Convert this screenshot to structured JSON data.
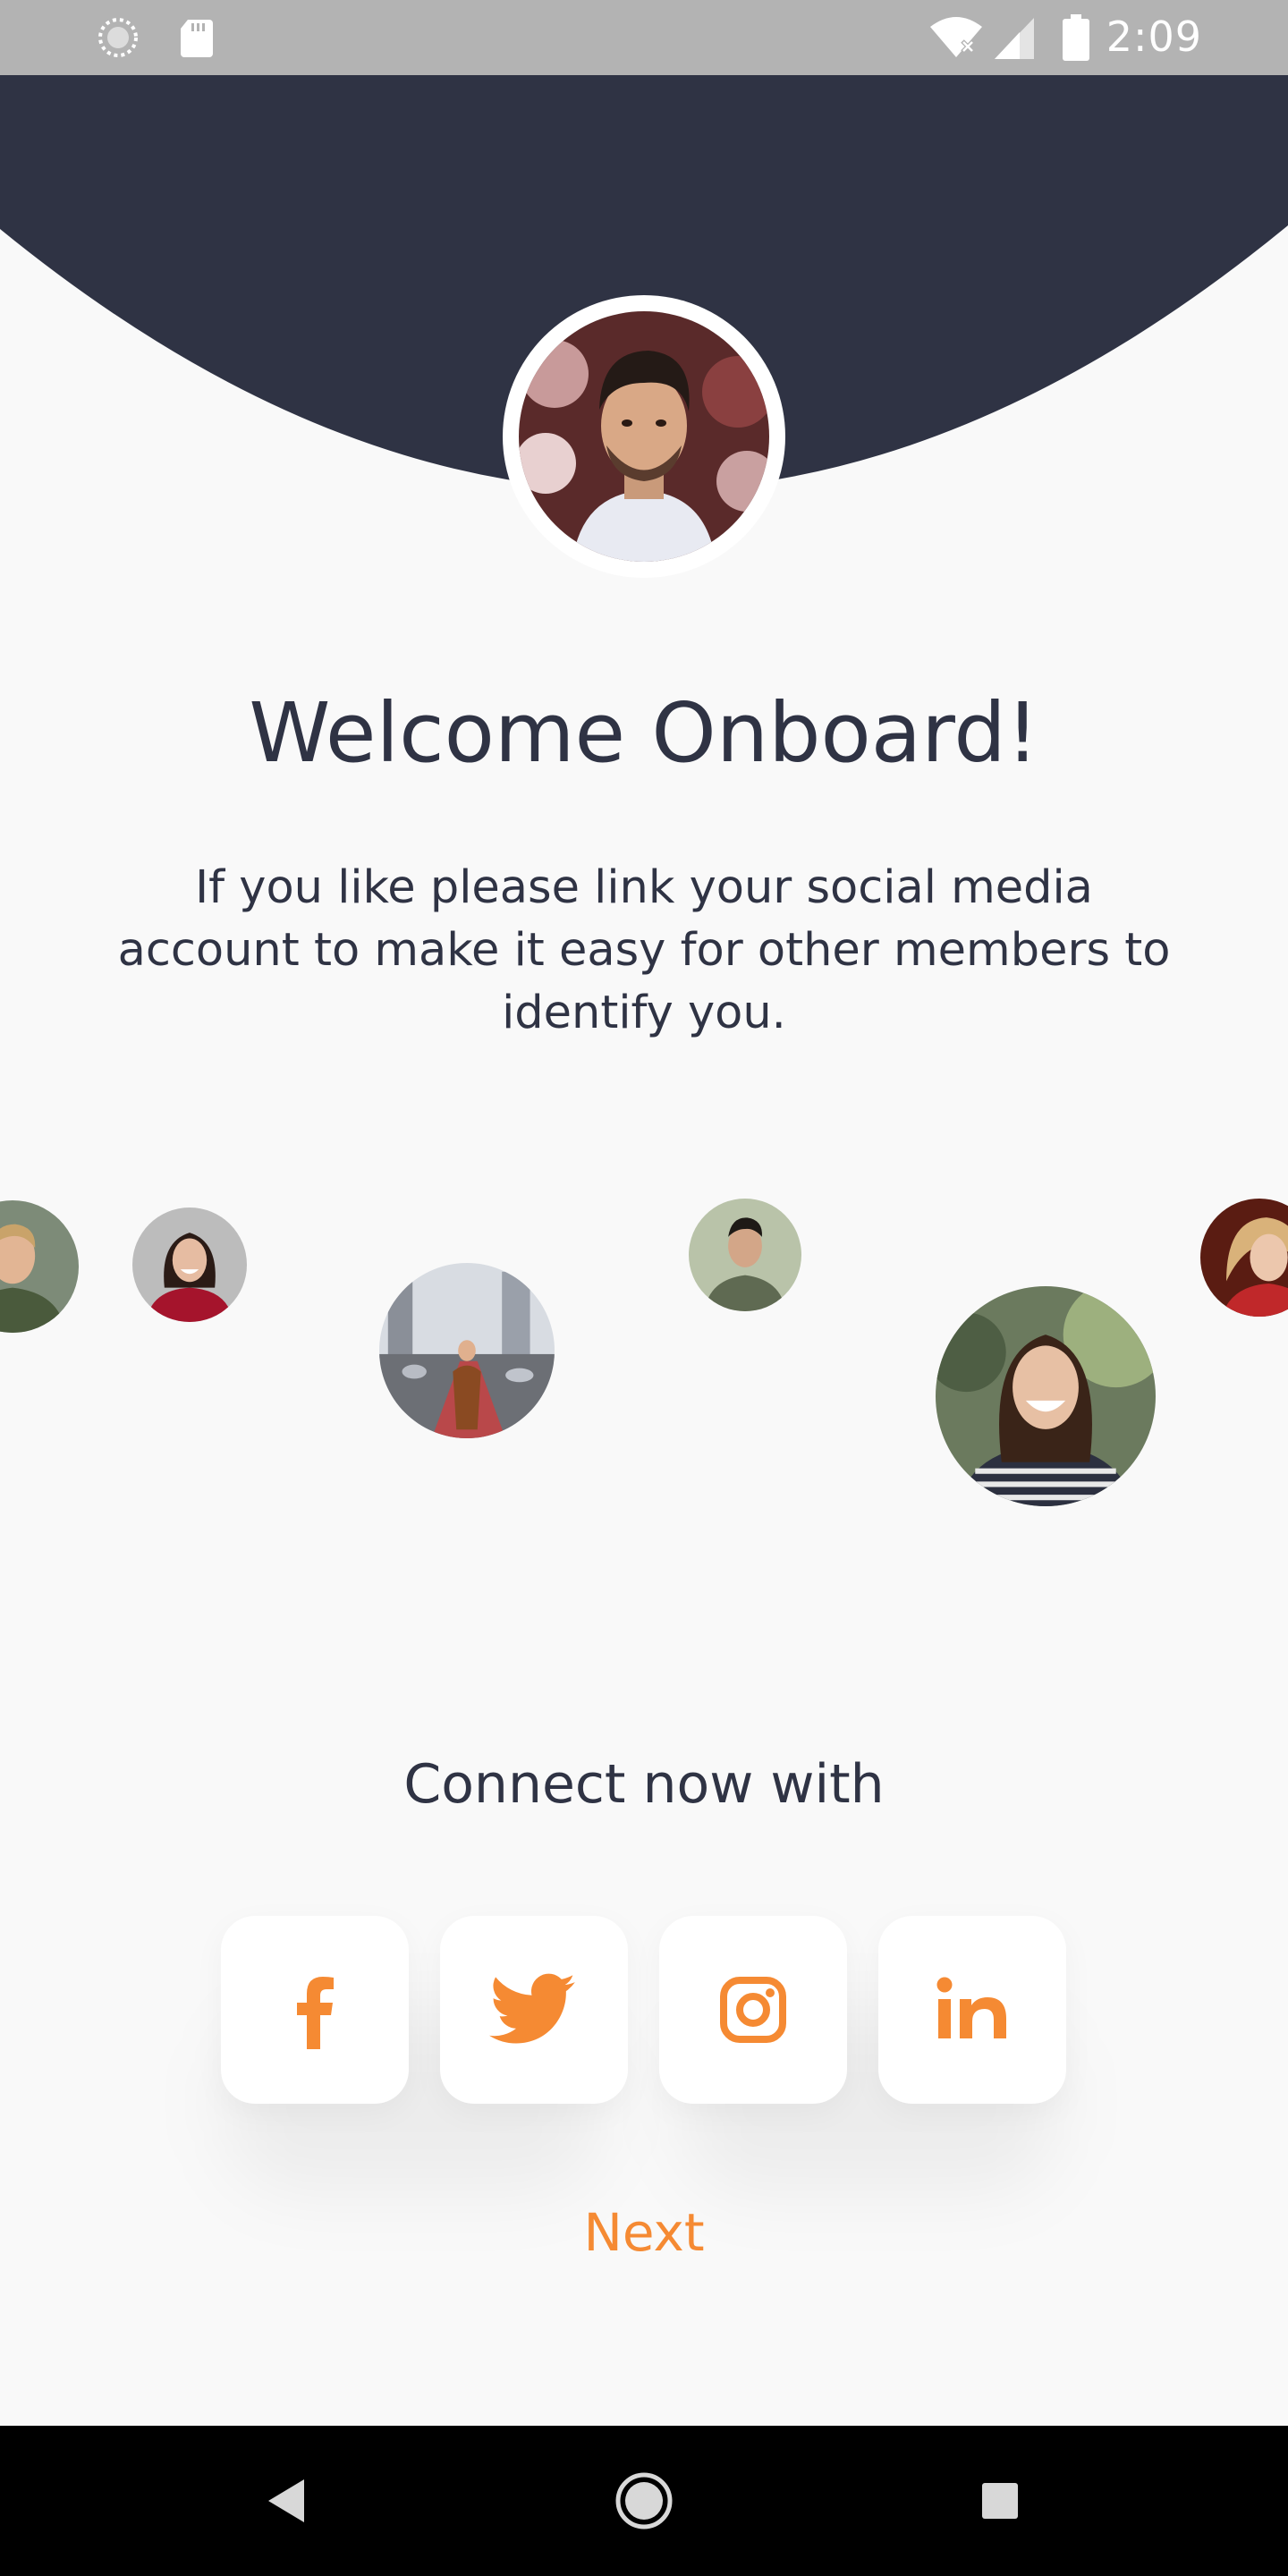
{
  "status_bar": {
    "time": "2:09",
    "icons": [
      "spinner-icon",
      "sd-card-icon",
      "wifi-off-icon",
      "cell-signal-icon",
      "battery-icon"
    ]
  },
  "welcome": {
    "title": "Welcome Onboard!",
    "description": "If you like please link your social media account to make it easy for other members to identify you."
  },
  "connect": {
    "label": "Connect now with",
    "networks": [
      "facebook",
      "twitter",
      "instagram",
      "linkedin"
    ]
  },
  "next_label": "Next",
  "colors": {
    "header": "#2f3344",
    "accent": "#f58a33",
    "background": "#f9f9f9"
  }
}
